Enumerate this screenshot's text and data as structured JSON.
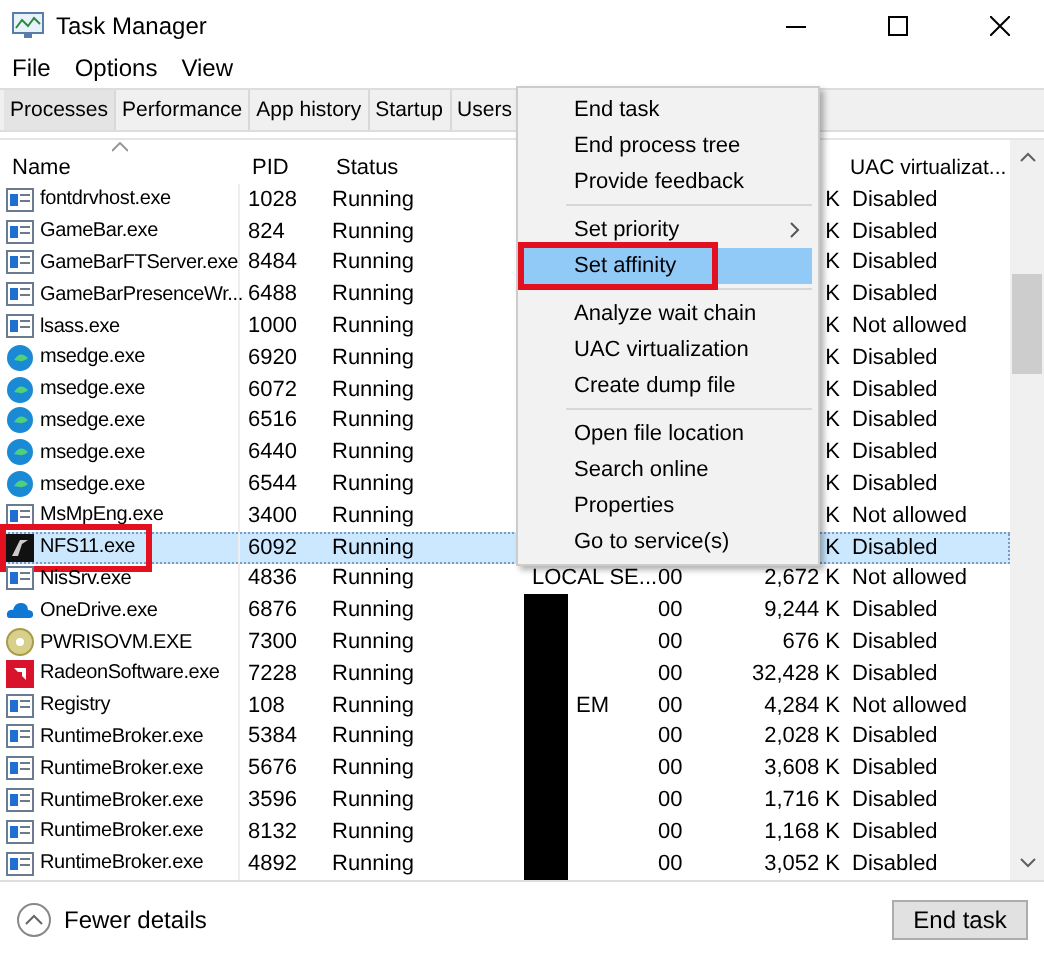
{
  "window": {
    "title": "Task Manager"
  },
  "menu_bar": [
    "File",
    "Options",
    "View"
  ],
  "tabs": [
    {
      "label": "Processes",
      "selected": true
    },
    {
      "label": "Performance",
      "selected": false
    },
    {
      "label": "App history",
      "selected": false
    },
    {
      "label": "Startup",
      "selected": false
    },
    {
      "label": "Users",
      "selected": false
    }
  ],
  "table": {
    "columns": [
      "Name",
      "PID",
      "Status",
      "UAC virtualizat..."
    ],
    "rows": [
      {
        "kind": "exe",
        "name": "fontdrvhost.exe",
        "pid": "1028",
        "status": "Running",
        "memory": "K",
        "uac": "Disabled",
        "selected": false
      },
      {
        "kind": "exe",
        "name": "GameBar.exe",
        "pid": "824",
        "status": "Running",
        "memory": "K",
        "uac": "Disabled",
        "selected": false
      },
      {
        "kind": "exe",
        "name": "GameBarFTServer.exe",
        "pid": "8484",
        "status": "Running",
        "memory": "K",
        "uac": "Disabled",
        "selected": false
      },
      {
        "kind": "exe",
        "name": "GameBarPresenceWr...",
        "pid": "6488",
        "status": "Running",
        "memory": "K",
        "uac": "Disabled",
        "selected": false
      },
      {
        "kind": "exe",
        "name": "lsass.exe",
        "pid": "1000",
        "status": "Running",
        "memory": "K",
        "uac": "Not allowed",
        "selected": false
      },
      {
        "kind": "edge",
        "name": "msedge.exe",
        "pid": "6920",
        "status": "Running",
        "memory": "K",
        "uac": "Disabled",
        "selected": false
      },
      {
        "kind": "edge",
        "name": "msedge.exe",
        "pid": "6072",
        "status": "Running",
        "memory": "K",
        "uac": "Disabled",
        "selected": false
      },
      {
        "kind": "edge",
        "name": "msedge.exe",
        "pid": "6516",
        "status": "Running",
        "memory": "K",
        "uac": "Disabled",
        "selected": false
      },
      {
        "kind": "edge",
        "name": "msedge.exe",
        "pid": "6440",
        "status": "Running",
        "memory": "K",
        "uac": "Disabled",
        "selected": false
      },
      {
        "kind": "edge",
        "name": "msedge.exe",
        "pid": "6544",
        "status": "Running",
        "memory": "K",
        "uac": "Disabled",
        "selected": false
      },
      {
        "kind": "exe",
        "name": "MsMpEng.exe",
        "pid": "3400",
        "status": "Running",
        "memory": "K",
        "uac": "Not allowed",
        "selected": false
      },
      {
        "kind": "game",
        "name": "NFS11.exe",
        "pid": "6092",
        "status": "Running",
        "memory": "K",
        "uac": "Disabled",
        "selected": true,
        "annotated": true
      },
      {
        "kind": "exe",
        "name": "NisSrv.exe",
        "pid": "4836",
        "status": "Running",
        "user": "LOCAL SE...",
        "cpu": "00",
        "memory": "2,672 K",
        "uac": "Not allowed",
        "selected": false
      },
      {
        "kind": "cloud",
        "name": "OneDrive.exe",
        "pid": "6876",
        "status": "Running",
        "redacted": true,
        "cpu": "00",
        "memory": "9,244 K",
        "uac": "Disabled",
        "selected": false
      },
      {
        "kind": "disc",
        "name": "PWRISOVM.EXE",
        "pid": "7300",
        "status": "Running",
        "redacted": true,
        "cpu": "00",
        "memory": "676 K",
        "uac": "Disabled",
        "selected": false
      },
      {
        "kind": "radeon",
        "name": "RadeonSoftware.exe",
        "pid": "7228",
        "status": "Running",
        "redacted": true,
        "cpu": "00",
        "memory": "32,428 K",
        "uac": "Disabled",
        "selected": false
      },
      {
        "kind": "exe",
        "name": "Registry",
        "pid": "108",
        "status": "Running",
        "redacted": true,
        "user": "EM",
        "cpu": "00",
        "memory": "4,284 K",
        "uac": "Not allowed",
        "selected": false
      },
      {
        "kind": "exe",
        "name": "RuntimeBroker.exe",
        "pid": "5384",
        "status": "Running",
        "redacted": true,
        "cpu": "00",
        "memory": "2,028 K",
        "uac": "Disabled",
        "selected": false
      },
      {
        "kind": "exe",
        "name": "RuntimeBroker.exe",
        "pid": "5676",
        "status": "Running",
        "redacted": true,
        "cpu": "00",
        "memory": "3,608 K",
        "uac": "Disabled",
        "selected": false
      },
      {
        "kind": "exe",
        "name": "RuntimeBroker.exe",
        "pid": "3596",
        "status": "Running",
        "redacted": true,
        "cpu": "00",
        "memory": "1,716 K",
        "uac": "Disabled",
        "selected": false
      },
      {
        "kind": "exe",
        "name": "RuntimeBroker.exe",
        "pid": "8132",
        "status": "Running",
        "redacted": true,
        "cpu": "00",
        "memory": "1,168 K",
        "uac": "Disabled",
        "selected": false
      },
      {
        "kind": "exe",
        "name": "RuntimeBroker.exe",
        "pid": "4892",
        "status": "Running",
        "redacted": true,
        "cpu": "00",
        "memory": "3,052 K",
        "uac": "Disabled",
        "selected": false
      }
    ]
  },
  "context_menu": [
    {
      "kind": "item",
      "label": "End task"
    },
    {
      "kind": "item",
      "label": "End process tree"
    },
    {
      "kind": "item",
      "label": "Provide feedback"
    },
    {
      "kind": "separator"
    },
    {
      "kind": "item",
      "label": "Set priority",
      "submenu": true
    },
    {
      "kind": "item",
      "label": "Set affinity",
      "selected": true,
      "annotated": true
    },
    {
      "kind": "separator"
    },
    {
      "kind": "item",
      "label": "Analyze wait chain"
    },
    {
      "kind": "item",
      "label": "UAC virtualization"
    },
    {
      "kind": "item",
      "label": "Create dump file"
    },
    {
      "kind": "separator"
    },
    {
      "kind": "item",
      "label": "Open file location"
    },
    {
      "kind": "item",
      "label": "Search online"
    },
    {
      "kind": "item",
      "label": "Properties"
    },
    {
      "kind": "item",
      "label": "Go to service(s)"
    }
  ],
  "footer": {
    "details_link": "Fewer details",
    "end_task_button": "End task"
  }
}
